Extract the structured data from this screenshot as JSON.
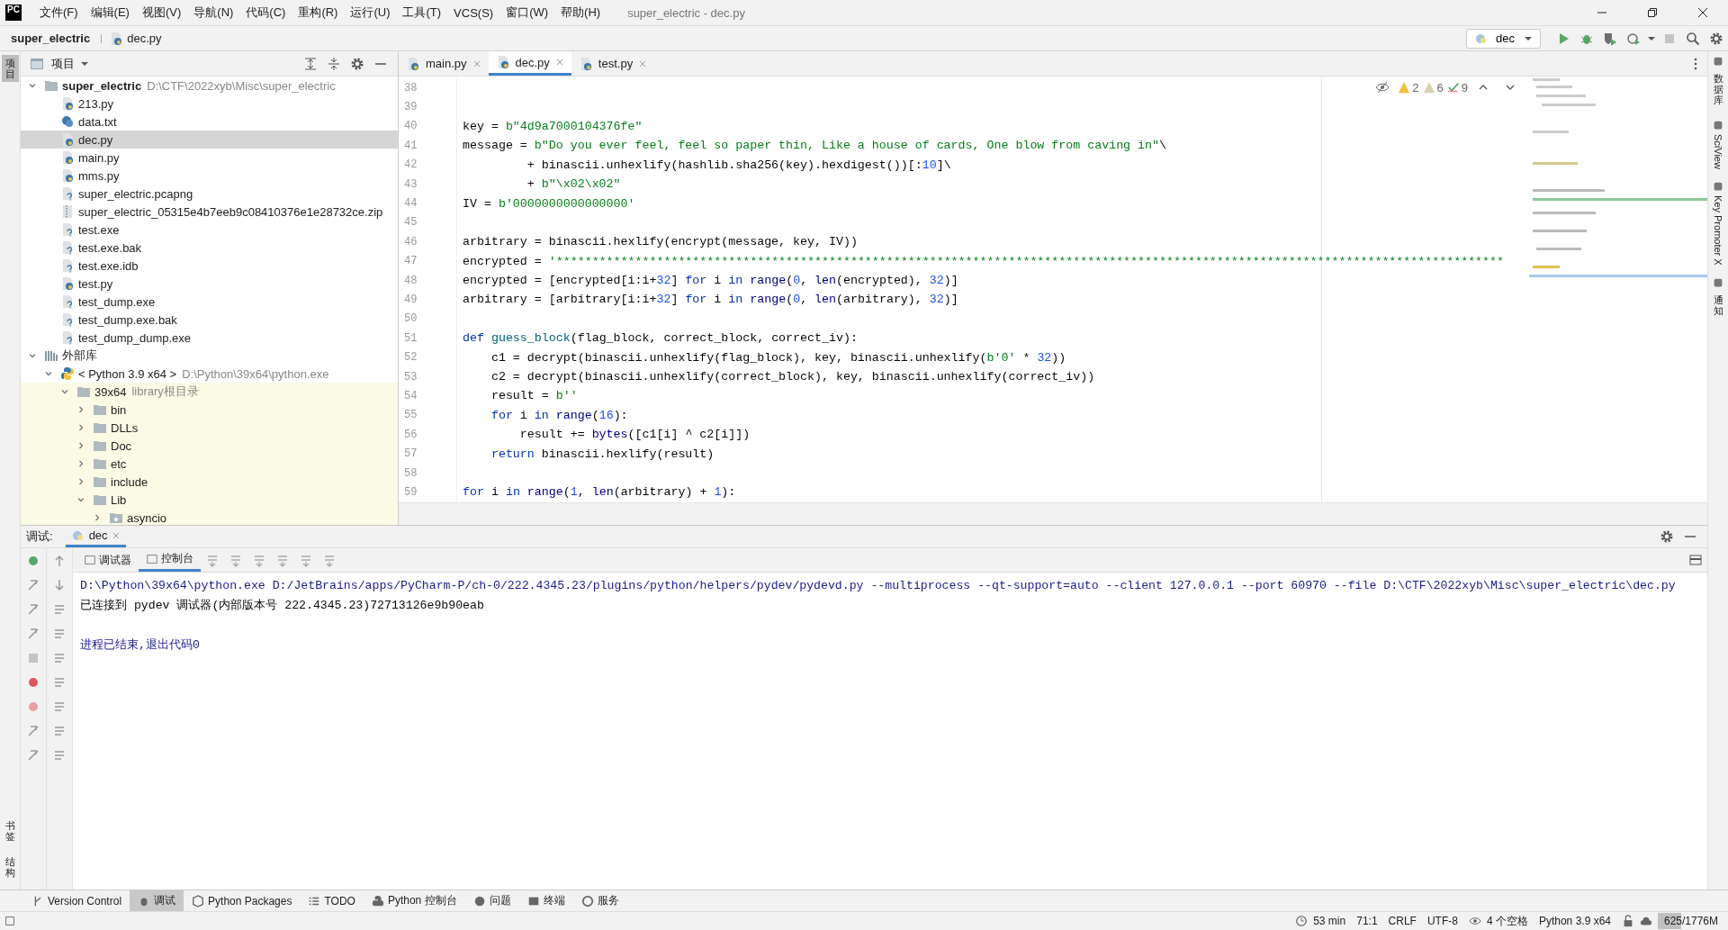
{
  "window": {
    "logo": "PC",
    "menu": [
      "文件(F)",
      "编辑(E)",
      "视图(V)",
      "导航(N)",
      "代码(C)",
      "重构(R)",
      "运行(U)",
      "工具(T)",
      "VCS(S)",
      "窗口(W)",
      "帮助(H)"
    ],
    "title": "super_electric - dec.py"
  },
  "breadcrumb": [
    {
      "label": "super_electric",
      "kind": "project"
    },
    {
      "label": "dec.py",
      "kind": "py"
    }
  ],
  "run_config": "dec",
  "left_stripe": {
    "top": [
      {
        "label": "项目",
        "selected": true
      }
    ],
    "bottom": [
      {
        "label": "书签",
        "selected": false
      },
      {
        "label": "结构",
        "selected": false
      }
    ]
  },
  "right_stripe": [
    {
      "label": "数据库",
      "kind": "cjk"
    },
    {
      "label": "SciView",
      "kind": "latin"
    },
    {
      "label": "Key Promoter X",
      "kind": "latin"
    },
    {
      "label": "通知",
      "kind": "cjk"
    }
  ],
  "project_panel": {
    "title": "项目"
  },
  "project_tree": [
    {
      "label": "super_electric",
      "kind": "folder",
      "hint": "D:\\CTF\\2022xyb\\Misc\\super_electric",
      "bold": true,
      "expanded": true,
      "selected": false,
      "children": [
        {
          "label": "213.py",
          "kind": "py",
          "selected": false
        },
        {
          "label": "data.txt",
          "kind": "txt",
          "selected": false
        },
        {
          "label": "dec.py",
          "kind": "py",
          "selected": true
        },
        {
          "label": "main.py",
          "kind": "py",
          "selected": false
        },
        {
          "label": "mms.py",
          "kind": "py",
          "selected": false
        },
        {
          "label": "super_electric.pcapng",
          "kind": "unknown",
          "selected": false
        },
        {
          "label": "super_electric_05315e4b7eeb9c08410376e1e28732ce.zip",
          "kind": "zip",
          "selected": false
        },
        {
          "label": "test.exe",
          "kind": "unknown",
          "selected": false
        },
        {
          "label": "test.exe.bak",
          "kind": "unknown",
          "selected": false
        },
        {
          "label": "test.exe.idb",
          "kind": "unknown",
          "selected": false
        },
        {
          "label": "test.py",
          "kind": "py",
          "selected": false
        },
        {
          "label": "test_dump.exe",
          "kind": "unknown",
          "selected": false
        },
        {
          "label": "test_dump.exe.bak",
          "kind": "unknown",
          "selected": false
        },
        {
          "label": "test_dump_dump.exe",
          "kind": "unknown",
          "selected": false
        }
      ]
    },
    {
      "label": "外部库",
      "kind": "libraries",
      "expanded": true,
      "selected": false,
      "children": [
        {
          "label": "< Python 3.9 x64 >",
          "kind": "sdk",
          "hint": "D:\\Python\\39x64\\python.exe",
          "expanded": true,
          "selected": false,
          "children": [
            {
              "label": "39x64",
              "kind": "folder",
              "hint": "library根目录",
              "library": true,
              "expanded": true,
              "selected": false,
              "children": [
                {
                  "label": "bin",
                  "kind": "folder",
                  "expanded": false,
                  "selected": false
                },
                {
                  "label": "DLLs",
                  "kind": "folder",
                  "expanded": false,
                  "selected": false
                },
                {
                  "label": "Doc",
                  "kind": "folder",
                  "expanded": false,
                  "selected": false
                },
                {
                  "label": "etc",
                  "kind": "folder",
                  "expanded": false,
                  "selected": false
                },
                {
                  "label": "include",
                  "kind": "folder",
                  "expanded": false,
                  "selected": false
                },
                {
                  "label": "Lib",
                  "kind": "folder",
                  "expanded": true,
                  "selected": false,
                  "children": [
                    {
                      "label": "asyncio",
                      "kind": "package",
                      "expanded": false,
                      "selected": false
                    }
                  ]
                }
              ]
            }
          ]
        }
      ]
    }
  ],
  "editor_tabs": [
    {
      "label": "main.py",
      "selected": false
    },
    {
      "label": "dec.py",
      "selected": true
    },
    {
      "label": "test.py",
      "selected": false
    }
  ],
  "inspections": [
    {
      "kind": "warning",
      "count": "2"
    },
    {
      "kind": "weak",
      "count": "6"
    },
    {
      "kind": "typo",
      "count": "9"
    }
  ],
  "code": [
    {
      "number": "38"
    },
    {
      "number": "39"
    },
    {
      "number": "40",
      "tokens": [
        {
          "kind": "plain",
          "text": "key = "
        },
        {
          "kind": "str",
          "text": "b\"4d9a7000104376fe\""
        }
      ]
    },
    {
      "number": "41",
      "tokens": [
        {
          "kind": "plain",
          "text": "message = "
        },
        {
          "kind": "str",
          "text": "b\"Do you ever feel, feel so paper thin, Like a house of cards, One blow from caving in\""
        },
        {
          "kind": "plain",
          "text": "\\"
        }
      ]
    },
    {
      "number": "42",
      "tokens": [
        {
          "kind": "plain",
          "text": "         + binascii.unhexlify(hashlib.sha256(key).hexdigest())[:"
        },
        {
          "kind": "num",
          "text": "10"
        },
        {
          "kind": "plain",
          "text": "]\\"
        }
      ]
    },
    {
      "number": "43",
      "tokens": [
        {
          "kind": "plain",
          "text": "         + "
        },
        {
          "kind": "str",
          "text": "b\"\\x02\\x02\""
        }
      ]
    },
    {
      "number": "44",
      "tokens": [
        {
          "kind": "plain",
          "text": "IV = "
        },
        {
          "kind": "str",
          "text": "b'0000000000000000'"
        }
      ]
    },
    {
      "number": "45"
    },
    {
      "number": "46",
      "tokens": [
        {
          "kind": "plain",
          "text": "arbitrary = binascii.hexlify(encrypt(message, key, IV))"
        }
      ]
    },
    {
      "number": "47",
      "tokens": [
        {
          "kind": "plain",
          "text": "encrypted = "
        },
        {
          "kind": "str",
          "text": "'************************************************************************************************************************************"
        }
      ]
    },
    {
      "number": "48",
      "tokens": [
        {
          "kind": "plain",
          "text": "encrypted = [encrypted[i:i+"
        },
        {
          "kind": "num",
          "text": "32"
        },
        {
          "kind": "plain",
          "text": "] "
        },
        {
          "kind": "kw",
          "text": "for"
        },
        {
          "kind": "plain",
          "text": " i "
        },
        {
          "kind": "kw",
          "text": "in"
        },
        {
          "kind": "builtin",
          "text": " range"
        },
        {
          "kind": "plain",
          "text": "("
        },
        {
          "kind": "num",
          "text": "0"
        },
        {
          "kind": "plain",
          "text": ", "
        },
        {
          "kind": "builtin",
          "text": "len"
        },
        {
          "kind": "plain",
          "text": "(encrypted), "
        },
        {
          "kind": "num",
          "text": "32"
        },
        {
          "kind": "plain",
          "text": ")]"
        }
      ]
    },
    {
      "number": "49",
      "tokens": [
        {
          "kind": "plain",
          "text": "arbitrary = [arbitrary[i:i+"
        },
        {
          "kind": "num",
          "text": "32"
        },
        {
          "kind": "plain",
          "text": "] "
        },
        {
          "kind": "kw",
          "text": "for"
        },
        {
          "kind": "plain",
          "text": " i "
        },
        {
          "kind": "kw",
          "text": "in"
        },
        {
          "kind": "builtin",
          "text": " range"
        },
        {
          "kind": "plain",
          "text": "("
        },
        {
          "kind": "num",
          "text": "0"
        },
        {
          "kind": "plain",
          "text": ", "
        },
        {
          "kind": "builtin",
          "text": "len"
        },
        {
          "kind": "plain",
          "text": "(arbitrary), "
        },
        {
          "kind": "num",
          "text": "32"
        },
        {
          "kind": "plain",
          "text": ")]"
        }
      ]
    },
    {
      "number": "50"
    },
    {
      "number": "51",
      "tokens": [
        {
          "kind": "kw",
          "text": "def"
        },
        {
          "kind": "fn",
          "text": " guess_block"
        },
        {
          "kind": "plain",
          "text": "(flag_block, correct_block, correct_iv):"
        }
      ]
    },
    {
      "number": "52",
      "tokens": [
        {
          "kind": "plain",
          "text": "    c1 = decrypt(binascii.unhexlify(flag_block), key, binascii.unhexlify("
        },
        {
          "kind": "str",
          "text": "b'0'"
        },
        {
          "kind": "plain",
          "text": " * "
        },
        {
          "kind": "num",
          "text": "32"
        },
        {
          "kind": "plain",
          "text": "))"
        }
      ]
    },
    {
      "number": "53",
      "tokens": [
        {
          "kind": "plain",
          "text": "    c2 = decrypt(binascii.unhexlify(correct_block), key, binascii.unhexlify(correct_iv))"
        }
      ]
    },
    {
      "number": "54",
      "tokens": [
        {
          "kind": "plain",
          "text": "    result = "
        },
        {
          "kind": "str",
          "text": "b''"
        }
      ]
    },
    {
      "number": "55",
      "tokens": [
        {
          "kind": "kw",
          "text": "    for"
        },
        {
          "kind": "plain",
          "text": " i "
        },
        {
          "kind": "kw",
          "text": "in"
        },
        {
          "kind": "builtin",
          "text": " range"
        },
        {
          "kind": "plain",
          "text": "("
        },
        {
          "kind": "num",
          "text": "16"
        },
        {
          "kind": "plain",
          "text": "):"
        }
      ]
    },
    {
      "number": "56",
      "tokens": [
        {
          "kind": "plain",
          "text": "        result += "
        },
        {
          "kind": "builtin",
          "text": "bytes"
        },
        {
          "kind": "plain",
          "text": "([c1[i] ^ c2[i]])"
        }
      ]
    },
    {
      "number": "57",
      "tokens": [
        {
          "kind": "kw",
          "text": "    return"
        },
        {
          "kind": "plain",
          "text": " binascii.hexlify(result)"
        }
      ]
    },
    {
      "number": "58"
    },
    {
      "number": "59",
      "tokens": [
        {
          "kind": "kw",
          "text": "for"
        },
        {
          "kind": "plain",
          "text": " i "
        },
        {
          "kind": "kw",
          "text": "in"
        },
        {
          "kind": "builtin",
          "text": " range"
        },
        {
          "kind": "plain",
          "text": "("
        },
        {
          "kind": "num",
          "text": "1"
        },
        {
          "kind": "plain",
          "text": ", "
        },
        {
          "kind": "builtin",
          "text": "len"
        },
        {
          "kind": "plain",
          "text": "(arbitrary) + "
        },
        {
          "kind": "num",
          "text": "1"
        },
        {
          "kind": "plain",
          "text": "):"
        }
      ]
    }
  ],
  "debug_panel": {
    "label": "调试:",
    "tabs": [
      {
        "label": "dec",
        "selected": true
      }
    ],
    "subtabs": [
      {
        "label": "调试器",
        "selected": false
      },
      {
        "label": "控制台",
        "selected": true
      }
    ],
    "console": [
      {
        "kind": "command",
        "text": "D:\\Python\\39x64\\python.exe D:/JetBrains/apps/PyCharm-P/ch-0/222.4345.23/plugins/python/helpers/pydev/pydevd.py --multiprocess --qt-support=auto --client 127.0.0.1 --port 60970 --file D:\\CTF\\2022xyb\\Misc\\super_electric\\dec.py"
      },
      {
        "kind": "info",
        "text": "已连接到 pydev 调试器(内部版本号 222.4345.23)72713126e9b90eab"
      },
      {
        "kind": "blank"
      },
      {
        "kind": "exit",
        "text": "进程已结束,退出代码0"
      }
    ]
  },
  "tool_tabs": [
    {
      "label": "Version Control",
      "kind": "vcs",
      "selected": false
    },
    {
      "label": "调试",
      "kind": "debug",
      "selected": true
    },
    {
      "label": "Python Packages",
      "kind": "packages",
      "selected": false
    },
    {
      "label": "TODO",
      "kind": "todo",
      "selected": false
    },
    {
      "label": "Python 控制台",
      "kind": "console",
      "selected": false
    },
    {
      "label": "问题",
      "kind": "problems",
      "selected": false
    },
    {
      "label": "终端",
      "kind": "terminal",
      "selected": false
    },
    {
      "label": "服务",
      "kind": "services",
      "selected": false
    }
  ],
  "status_bar": [
    {
      "kind": "time",
      "text": "53 min"
    },
    {
      "kind": "plain",
      "text": "71:1"
    },
    {
      "kind": "plain",
      "text": "CRLF"
    },
    {
      "kind": "plain",
      "text": "UTF-8"
    },
    {
      "kind": "indent",
      "text": "4 个空格"
    },
    {
      "kind": "interpreter",
      "text": "Python 3.9 x64"
    },
    {
      "kind": "memory",
      "text": "625/1776M",
      "level": 0.35
    }
  ]
}
